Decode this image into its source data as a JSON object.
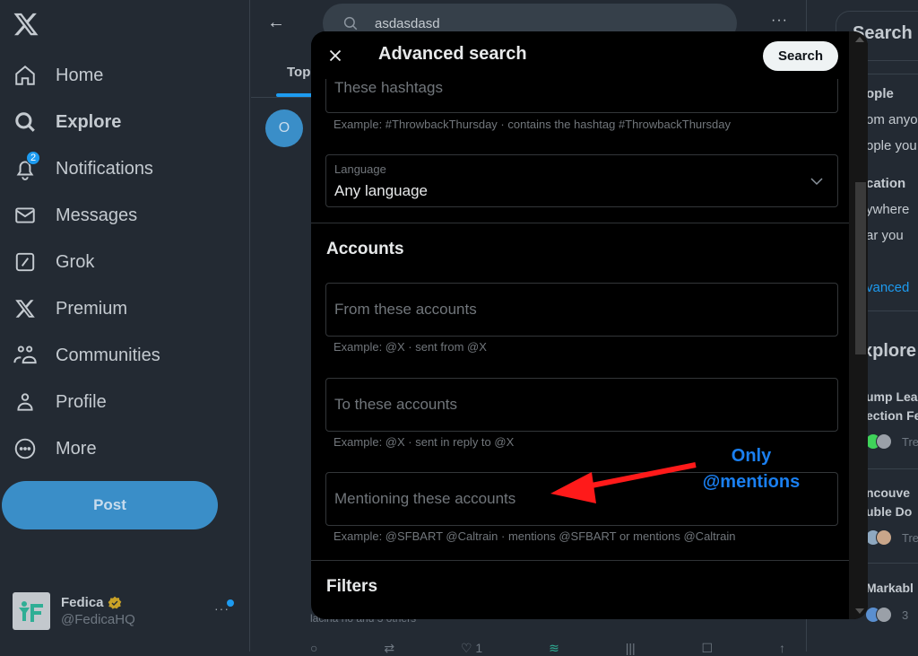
{
  "sidebar": {
    "logo": "x-logo-icon",
    "items": [
      {
        "label": "Home",
        "icon": "home-icon"
      },
      {
        "label": "Explore",
        "icon": "search-icon",
        "active": true
      },
      {
        "label": "Notifications",
        "icon": "bell-icon",
        "badge": "2"
      },
      {
        "label": "Messages",
        "icon": "envelope-icon"
      },
      {
        "label": "Grok",
        "icon": "grok-icon"
      },
      {
        "label": "Premium",
        "icon": "x-logo-icon"
      },
      {
        "label": "Communities",
        "icon": "people-icon"
      },
      {
        "label": "Profile",
        "icon": "person-icon"
      },
      {
        "label": "More",
        "icon": "more-circle-icon"
      }
    ],
    "post_label": "Post",
    "account": {
      "name": "Fedica",
      "handle": "@FedicaHQ",
      "more": "···"
    }
  },
  "main": {
    "search_query": "asdasdasd",
    "more": "···",
    "tab_top": "Top",
    "tweet_avatar_initial": "O",
    "tweet_liked_text": "lacina ho and 3 others",
    "actions": [
      "○",
      "⇄",
      "♡ 1",
      "≋",
      "|||",
      "☐",
      "↑"
    ]
  },
  "right": {
    "search_title": "Search",
    "lines": [
      {
        "text": "ople",
        "style": "bold"
      },
      {
        "text": "om anyo",
        "style": "normal"
      },
      {
        "text": "ople you",
        "style": "normal"
      },
      {
        "text": "cation",
        "style": "bold"
      },
      {
        "text": "ywhere",
        "style": "normal"
      },
      {
        "text": "ar you",
        "style": "normal"
      },
      {
        "text": "vanced",
        "style": "link"
      }
    ],
    "explore_heading": "xplore",
    "trends": [
      {
        "line1": "ump Lea",
        "line2": "ection Fe",
        "sub": "Tre"
      },
      {
        "line1": "ncouve",
        "line2": "uble Do",
        "sub": "Tre"
      },
      {
        "line1": "Markabl",
        "line2": "",
        "sub": "3"
      }
    ]
  },
  "modal": {
    "title": "Advanced search",
    "search_button": "Search",
    "hashtags_placeholder": "These hashtags",
    "hashtags_hint": "Example: #ThrowbackThursday · contains the hashtag #ThrowbackThursday",
    "language_label": "Language",
    "language_value": "Any language",
    "accounts_title": "Accounts",
    "from_placeholder": "From these accounts",
    "from_hint": "Example: @X · sent from @X",
    "to_placeholder": "To these accounts",
    "to_hint": "Example: @X · sent in reply to @X",
    "mention_placeholder": "Mentioning these accounts",
    "mention_hint": "Example: @SFBART @Caltrain · mentions @SFBART or mentions @Caltrain",
    "filters_title": "Filters"
  },
  "annotation": {
    "line1": "Only",
    "line2": "@mentions",
    "color": "#1a7ff0",
    "arrow_color": "#ff1a1a"
  }
}
